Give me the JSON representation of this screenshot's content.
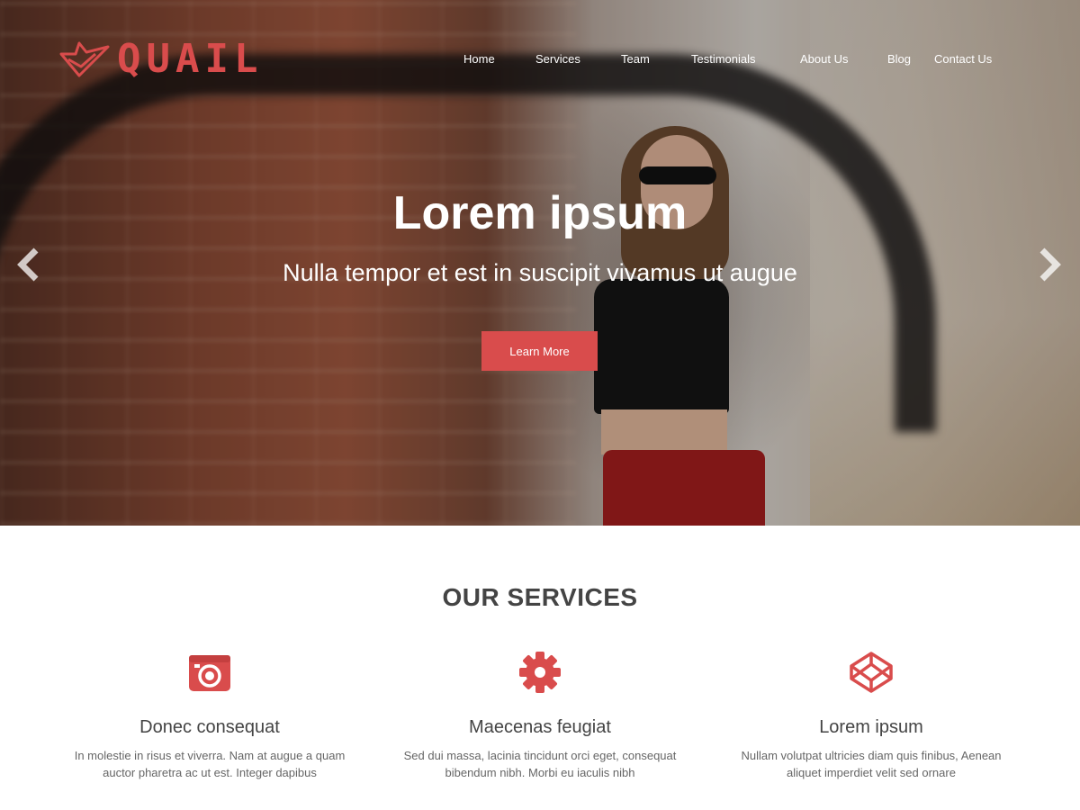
{
  "brand": {
    "name": "QUAIL",
    "accent": "#d94c4c"
  },
  "nav": {
    "items": [
      {
        "label": "Home"
      },
      {
        "label": "Services"
      },
      {
        "label": "Team"
      },
      {
        "label": "Testimonials"
      },
      {
        "label": "About Us"
      },
      {
        "label": "Blog"
      },
      {
        "label": "Contact Us"
      }
    ]
  },
  "hero": {
    "title": "Lorem ipsum",
    "subtitle": "Nulla tempor et est in suscipit vivamus ut augue",
    "cta_label": "Learn More",
    "prev_icon": "chevron-left-icon",
    "next_icon": "chevron-right-icon"
  },
  "services": {
    "title": "OUR SERVICES",
    "items": [
      {
        "icon": "camera-icon",
        "title": "Donec consequat",
        "lines": [
          "In molestie in risus et viverra. Nam at augue a quam",
          "auctor pharetra ac ut est. Integer dapibus"
        ]
      },
      {
        "icon": "gear-icon",
        "title": "Maecenas feugiat",
        "lines": [
          "Sed dui massa, lacinia tincidunt orci eget, consequat",
          "bibendum nibh. Morbi eu iaculis nibh"
        ]
      },
      {
        "icon": "codepen-icon",
        "title": "Lorem ipsum",
        "lines": [
          "Nullam volutpat ultricies diam quis finibus, Aenean",
          "aliquet imperdiet velit sed ornare"
        ]
      }
    ]
  }
}
